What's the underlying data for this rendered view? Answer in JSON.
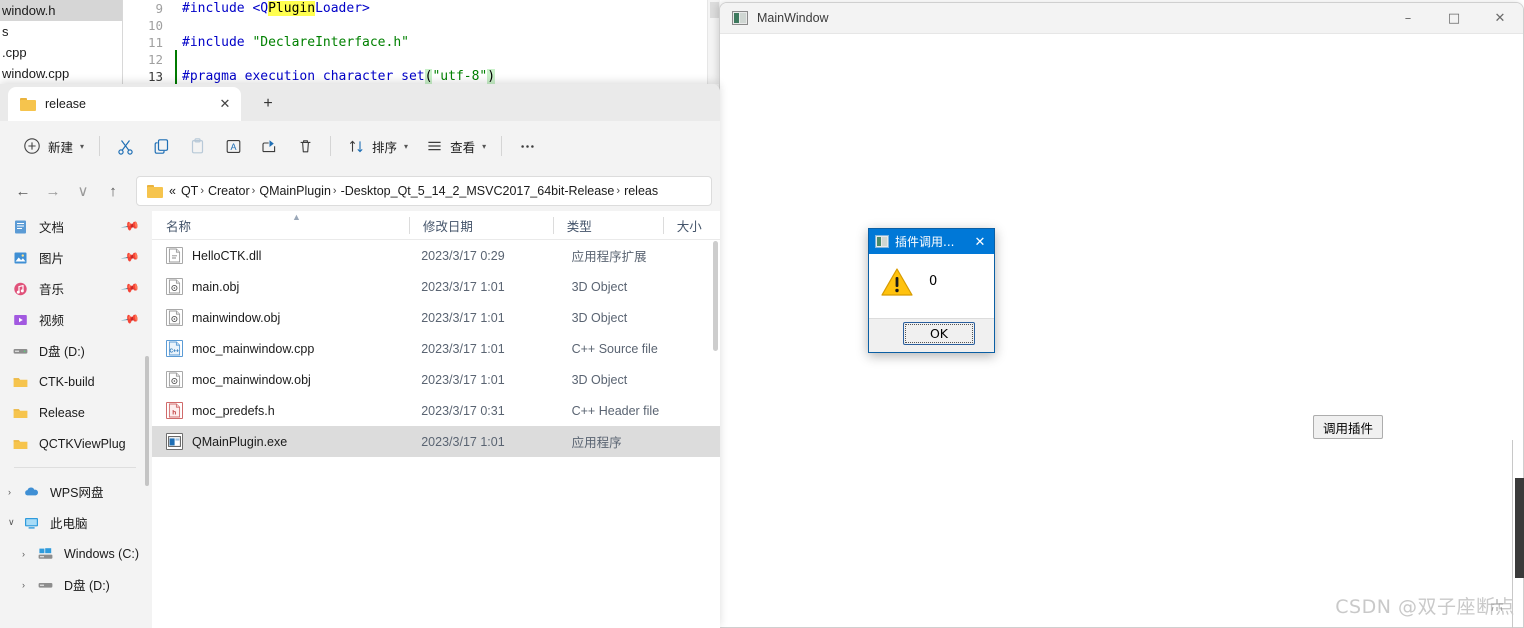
{
  "ide": {
    "tree_items": [
      {
        "label": "window.h",
        "selected": true
      },
      {
        "label": "s",
        "selected": false
      },
      {
        "label": ".cpp",
        "selected": false
      },
      {
        "label": "window.cpp",
        "selected": false
      }
    ],
    "line_numbers": [
      "9",
      "10",
      "11",
      "12",
      "13"
    ],
    "lines": [
      {
        "parts": [
          {
            "t": "#include ",
            "s": "pre"
          },
          {
            "t": "<Q",
            "s": "pre"
          },
          {
            "t": "Plugin",
            "s": "hl"
          },
          {
            "t": "Loader>",
            "s": "pre"
          }
        ]
      },
      {
        "parts": []
      },
      {
        "parts": [
          {
            "t": "#include ",
            "s": "pre"
          },
          {
            "t": "\"DeclareInterface.h\"",
            "s": "str"
          }
        ]
      },
      {
        "parts": []
      },
      {
        "parts": [
          {
            "t": "#pragma execution character set",
            "s": "pre"
          },
          {
            "t": "(",
            "s": "brace"
          },
          {
            "t": "\"utf-8\"",
            "s": "str"
          },
          {
            "t": ")",
            "s": "brace"
          }
        ]
      }
    ]
  },
  "explorer": {
    "tab": {
      "label": "release",
      "close_label": "✕",
      "new_tab_label": "+"
    },
    "toolbar": [
      {
        "name": "new",
        "label": "新建",
        "icon": "plus-circle-icon",
        "caret": true
      },
      {
        "name": "cut",
        "label": "",
        "icon": "scissors-icon",
        "caret": false
      },
      {
        "name": "copy",
        "label": "",
        "icon": "copy-icon",
        "caret": false
      },
      {
        "name": "paste",
        "label": "",
        "icon": "paste-icon",
        "caret": false
      },
      {
        "name": "rename",
        "label": "",
        "icon": "rename-icon",
        "caret": false
      },
      {
        "name": "share",
        "label": "",
        "icon": "share-icon",
        "caret": false
      },
      {
        "name": "delete",
        "label": "",
        "icon": "trash-icon",
        "caret": false
      },
      {
        "name": "sort",
        "label": "排序",
        "icon": "sort-icon",
        "caret": true
      },
      {
        "name": "view",
        "label": "查看",
        "icon": "view-icon",
        "caret": true
      },
      {
        "name": "more",
        "label": "",
        "icon": "ellipsis-icon",
        "caret": false
      }
    ],
    "nav": {
      "back": "←",
      "forward": "→",
      "recent": "∨",
      "up": "↑"
    },
    "breadcrumbs": [
      "«",
      "QT",
      "Creator",
      "QMainPlugin",
      "-Desktop_Qt_5_14_2_MSVC2017_64bit-Release",
      "releas"
    ],
    "sidebar": [
      {
        "label": "文档",
        "icon": "documents-icon",
        "pinned": true,
        "chev": "",
        "indent": 0
      },
      {
        "label": "图片",
        "icon": "pictures-icon",
        "pinned": true,
        "chev": "",
        "indent": 0
      },
      {
        "label": "音乐",
        "icon": "music-icon",
        "pinned": true,
        "chev": "",
        "indent": 0
      },
      {
        "label": "视频",
        "icon": "videos-icon",
        "pinned": true,
        "chev": "",
        "indent": 0
      },
      {
        "label": "D盘 (D:)",
        "icon": "drive-icon",
        "pinned": false,
        "chev": "",
        "indent": 0
      },
      {
        "label": "CTK-build",
        "icon": "folder-icon",
        "pinned": false,
        "chev": "",
        "indent": 0
      },
      {
        "label": "Release",
        "icon": "folder-icon",
        "pinned": false,
        "chev": "",
        "indent": 0
      },
      {
        "label": "QCTKViewPlug",
        "icon": "folder-icon",
        "pinned": false,
        "chev": "",
        "indent": 0
      }
    ],
    "sidebar_tree": [
      {
        "label": "WPS网盘",
        "icon": "cloud-icon",
        "chev": "›",
        "indent": 0
      },
      {
        "label": "此电脑",
        "icon": "pc-icon",
        "chev": "∨",
        "indent": 0
      },
      {
        "label": "Windows (C:)",
        "icon": "windrive-icon",
        "chev": "›",
        "indent": 1
      },
      {
        "label": "D盘 (D:)",
        "icon": "drive-icon",
        "chev": "›",
        "indent": 1
      }
    ],
    "columns": [
      "名称",
      "修改日期",
      "类型",
      "大小"
    ],
    "files": [
      {
        "name": "HelloCTK.dll",
        "date": "2023/3/17 0:29",
        "type": "应用程序扩展",
        "icon": "dll-file-icon",
        "icon_text": "",
        "selected": false
      },
      {
        "name": "main.obj",
        "date": "2023/3/17 1:01",
        "type": "3D Object",
        "icon": "obj-file-icon",
        "icon_text": "",
        "selected": false
      },
      {
        "name": "mainwindow.obj",
        "date": "2023/3/17 1:01",
        "type": "3D Object",
        "icon": "obj-file-icon",
        "icon_text": "",
        "selected": false
      },
      {
        "name": "moc_mainwindow.cpp",
        "date": "2023/3/17 1:01",
        "type": "C++ Source file",
        "icon": "cpp-file-icon",
        "icon_text": "C++",
        "selected": false
      },
      {
        "name": "moc_mainwindow.obj",
        "date": "2023/3/17 1:01",
        "type": "3D Object",
        "icon": "obj-file-icon",
        "icon_text": "",
        "selected": false
      },
      {
        "name": "moc_predefs.h",
        "date": "2023/3/17 0:31",
        "type": "C++ Header file",
        "icon": "header-file-icon",
        "icon_text": "h",
        "selected": false
      },
      {
        "name": "QMainPlugin.exe",
        "date": "2023/3/17 1:01",
        "type": "应用程序",
        "icon": "exe-file-icon",
        "icon_text": "",
        "selected": true
      }
    ]
  },
  "mainwindow": {
    "title": "MainWindow",
    "minimize": "–",
    "maximize": "□",
    "close": "✕",
    "call_plugin_button": "调用插件",
    "watermark": "CSDN @双子座断点"
  },
  "dialog": {
    "title": "插件调用...",
    "close": "✕",
    "message": "0",
    "ok_label": "OK",
    "icon": "warning-icon",
    "accent_color": "#0078d7",
    "warning_color": "#ffc20e"
  }
}
